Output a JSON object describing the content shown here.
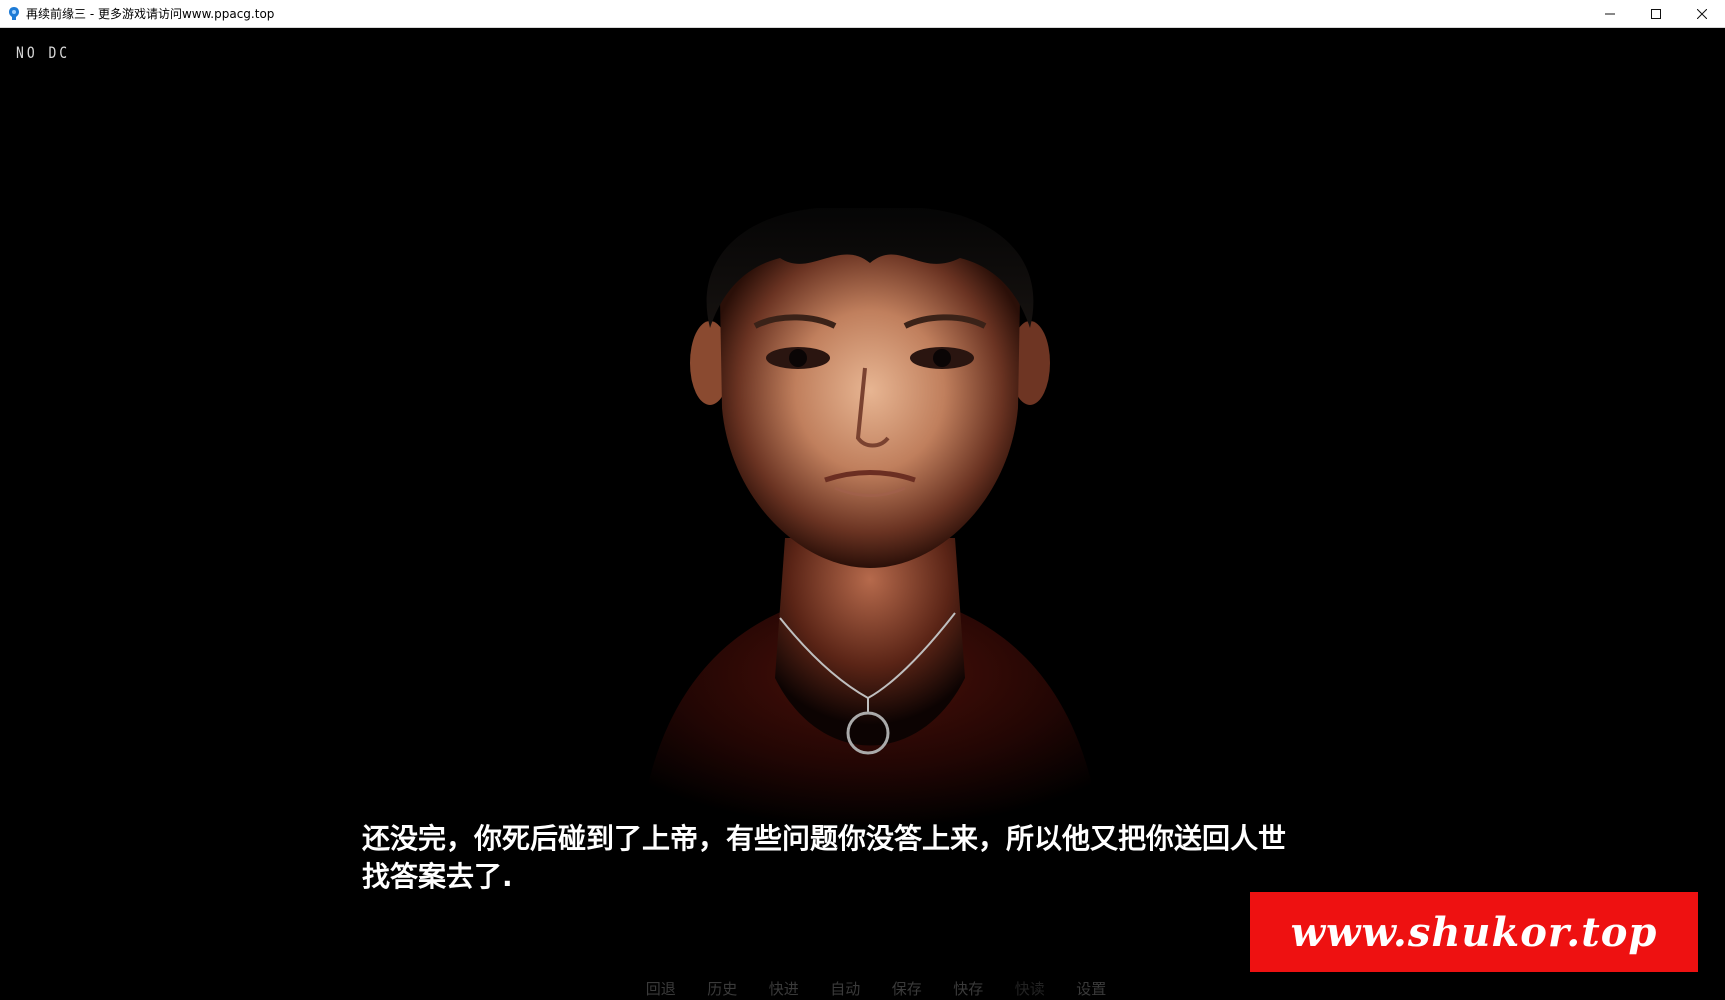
{
  "window": {
    "title": "再续前缘三 - 更多游戏请访问www.ppacg.top",
    "icon": "app-icon",
    "controls": {
      "minimize": "minimize-icon",
      "maximize": "maximize-icon",
      "close": "close-icon"
    }
  },
  "game": {
    "debug_label": "NO DC",
    "dialogue": {
      "line1": "还没完，你死后碰到了上帝，有些问题你没答上来，所以他又把你送回人世",
      "line2": "找答案去了."
    },
    "watermark": "www.shukor.top",
    "quick_menu": [
      {
        "label": "回退"
      },
      {
        "label": "历史"
      },
      {
        "label": "快进"
      },
      {
        "label": "自动"
      },
      {
        "label": "保存"
      },
      {
        "label": "快存"
      },
      {
        "label": "快读"
      },
      {
        "label": "设置"
      }
    ]
  },
  "colors": {
    "background": "#000000",
    "watermark_bg": "#ee1111",
    "dialogue_text": "#ffffff",
    "quick_menu_text": "#3a3a3a"
  }
}
